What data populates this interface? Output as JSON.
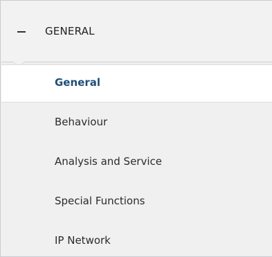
{
  "section": {
    "collapse_symbol": "minus-icon",
    "title": "GENERAL"
  },
  "nav": {
    "items": [
      {
        "label": "General",
        "selected": true
      },
      {
        "label": "Behaviour",
        "selected": false
      },
      {
        "label": "Analysis and Service",
        "selected": false
      },
      {
        "label": "Special Functions",
        "selected": false
      },
      {
        "label": "IP Network",
        "selected": false
      }
    ]
  },
  "colors": {
    "selected_text": "#1f4e79",
    "panel_background": "#f0f0f0",
    "selected_background": "#ffffff"
  }
}
